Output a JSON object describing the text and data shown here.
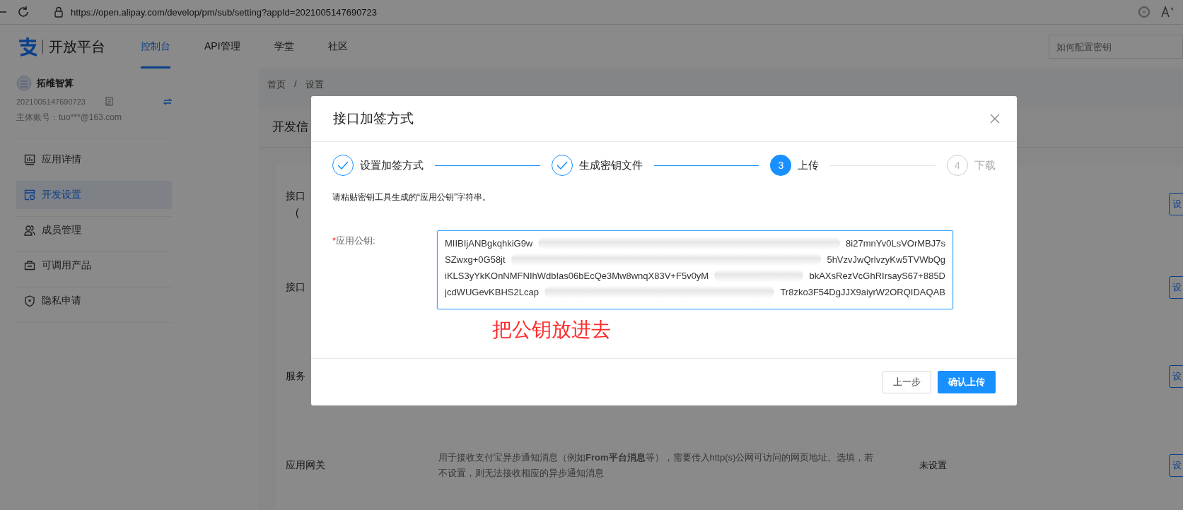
{
  "browser": {
    "url": "https://open.alipay.com/develop/pm/sub/setting?appId=2021005147690723"
  },
  "header": {
    "logo_text": "开放平台",
    "nav": [
      {
        "label": "控制台",
        "selected": true
      },
      {
        "label": "API管理",
        "selected": false
      },
      {
        "label": "学堂",
        "selected": false
      },
      {
        "label": "社区",
        "selected": false
      }
    ],
    "search": {
      "placeholder": "如何配置密钥"
    }
  },
  "sidebar": {
    "app_name": "拓维智算",
    "app_id": "2021005147690723",
    "account": "主体账号：tuo***@163.com",
    "items": [
      {
        "label": "应用详情",
        "selected": false
      },
      {
        "label": "开发设置",
        "selected": true
      },
      {
        "label": "成员管理",
        "selected": false
      },
      {
        "label": "可调用产品",
        "selected": false
      },
      {
        "label": "隐私申请",
        "selected": false
      }
    ]
  },
  "breadcrumb": [
    "首页",
    "/",
    "设置"
  ],
  "card": {
    "title": "开发信",
    "rows": [
      {
        "label": [
          "接口",
          "("
        ],
        "button": "设"
      },
      {
        "label": [
          "接口"
        ],
        "button": "设"
      },
      {
        "label": [
          "服务"
        ],
        "button": "设"
      },
      {
        "label": [
          "应用网关"
        ],
        "description": "用于接收支付宝异步通知消息（例如**From平台消息**等），需要传入http(s)公网可访问的网页地址。选填，若不设置，则无法接收相应的异步通知消息",
        "value": "未设置",
        "button": "设"
      }
    ]
  },
  "modal": {
    "title": "接口加签方式",
    "steps": [
      {
        "label": "设置加签方式",
        "kind": "done"
      },
      {
        "label": "生成密钥文件",
        "kind": "done"
      },
      {
        "number": "3",
        "label": "上传",
        "kind": "active"
      },
      {
        "number": "4",
        "label": "下载",
        "kind": "wait"
      }
    ],
    "instruction": "请粘贴密钥工具生成的“应用公钥”字符串。",
    "field": {
      "required_mark": "*",
      "label": "应用公钥:",
      "lines": [
        [
          "MIIBIjANBgkqhkiG9w",
          "8i27mnYv0LsVOrMBJ7s"
        ],
        [
          "SZwxg+0G58jt",
          "5hVzvJwQrlvzyKw5TVWbQg"
        ],
        [
          "iKLS3yYkKOnNMFNIhWdbIas06bEcQe3Mw8wnqX83V+F5v0yM",
          "bkAXsRezVcGhRIrsayS67+885D"
        ],
        [
          "jcdWUGevKBHS2Lcap",
          "Tr8zko3F54DgJJX9aiyrW2ORQIDAQAB"
        ]
      ]
    },
    "annotation": "把公钥放进去",
    "buttons": [
      {
        "label": "上一步",
        "kind": "default"
      },
      {
        "label": "确认上传",
        "kind": "primary"
      }
    ]
  }
}
